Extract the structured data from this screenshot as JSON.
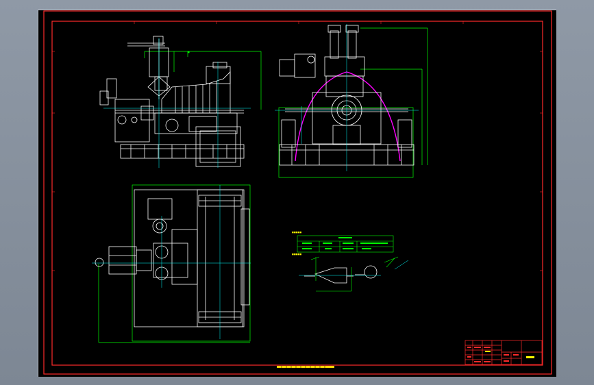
{
  "drawing": {
    "colors": {
      "background": "#000000",
      "frame": "#ff2a2a",
      "geometry": "#ffffff",
      "dimensions": "#00ff00",
      "centerlines": "#00ffff",
      "casing": "#ff00ff",
      "text_blocks": "#ffff00"
    }
  }
}
